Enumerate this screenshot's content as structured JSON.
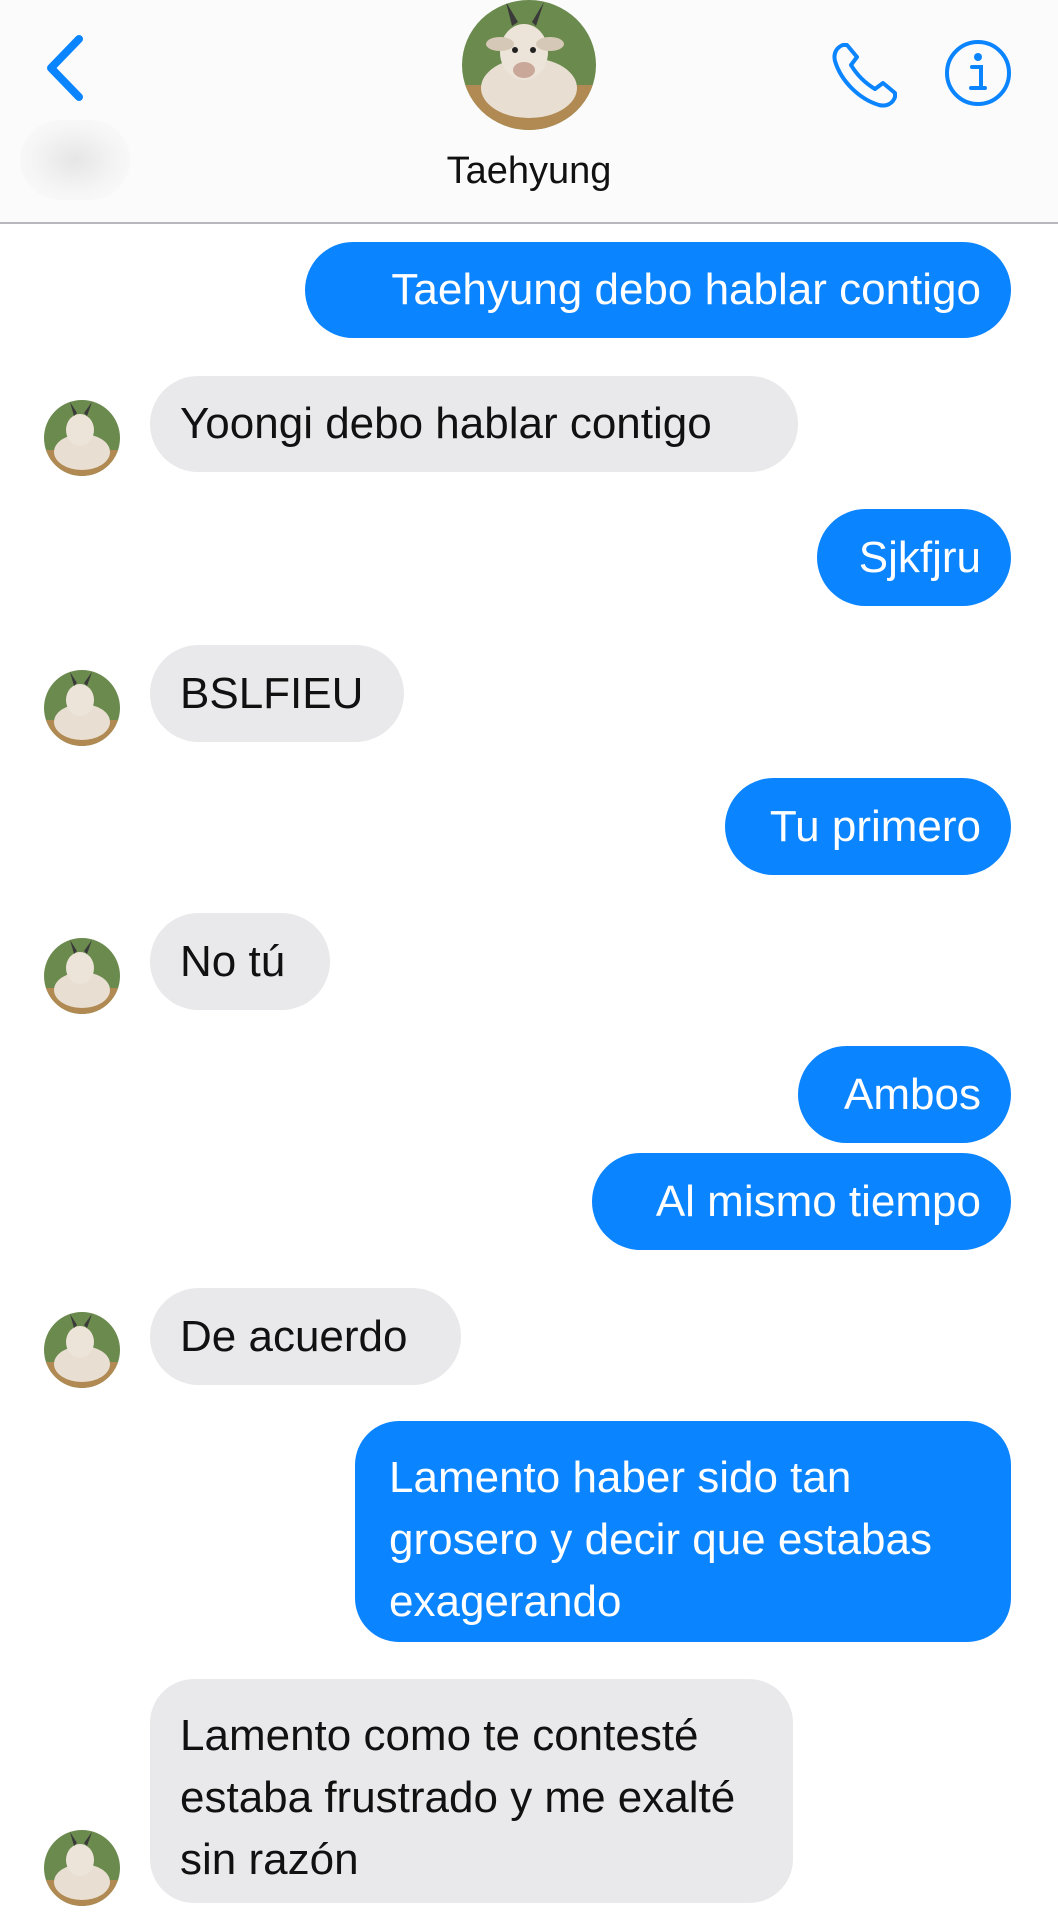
{
  "header": {
    "contact_name": "Taehyung",
    "back_icon": "chevron-left-icon",
    "call_icon": "phone-icon",
    "info_icon": "info-icon",
    "accent": "#0b84ff"
  },
  "messages": [
    {
      "from": "me",
      "text": "Taehyung debo hablar contigo"
    },
    {
      "from": "them",
      "text": "Yoongi debo hablar contigo"
    },
    {
      "from": "me",
      "text": "Sjkfjru"
    },
    {
      "from": "them",
      "text": "BSLFIEU"
    },
    {
      "from": "me",
      "text": "Tu primero"
    },
    {
      "from": "them",
      "text": "No tú"
    },
    {
      "from": "me",
      "text": "Ambos"
    },
    {
      "from": "me",
      "text": "Al mismo tiempo"
    },
    {
      "from": "them",
      "text": "De acuerdo"
    },
    {
      "from": "me",
      "text": "Lamento haber sido tan grosero y decir que estabas exagerando"
    },
    {
      "from": "them",
      "text": "Lamento como te contesté estaba frustrado y me exalté sin razón"
    }
  ],
  "colors": {
    "outgoing_bubble": "#0b84ff",
    "incoming_bubble": "#e9e9eb"
  }
}
